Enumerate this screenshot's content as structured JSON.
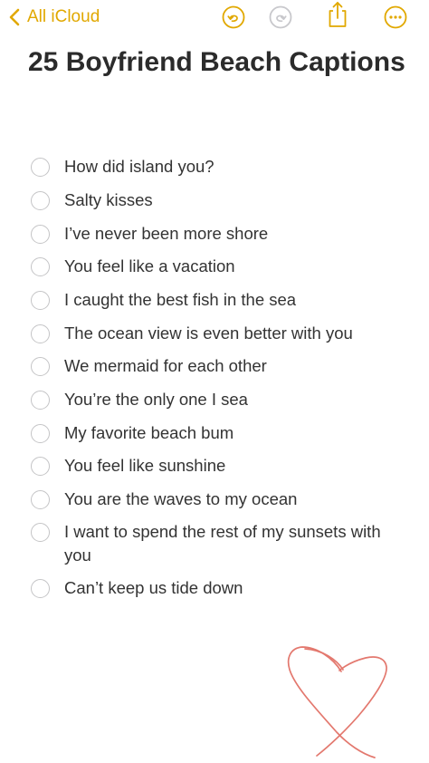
{
  "toolbar": {
    "back_label": "All iCloud",
    "icons": [
      "undo-icon",
      "redo-icon",
      "share-icon",
      "more-icon"
    ],
    "accent_color": "#e1a800",
    "disabled_color": "#c8c8cc"
  },
  "note": {
    "title": "25 Boyfriend Beach Captions",
    "checklist": [
      {
        "text": "How did island you?",
        "checked": false
      },
      {
        "text": "Salty kisses",
        "checked": false
      },
      {
        "text": "I’ve never been more shore",
        "checked": false
      },
      {
        "text": "You feel like a vacation",
        "checked": false
      },
      {
        "text": "I caught the best fish in the sea",
        "checked": false
      },
      {
        "text": "The ocean view is even better with you",
        "checked": false
      },
      {
        "text": "We mermaid for each other",
        "checked": false
      },
      {
        "text": "You’re the only one I sea",
        "checked": false
      },
      {
        "text": "My favorite beach bum",
        "checked": false
      },
      {
        "text": "You feel like sunshine",
        "checked": false
      },
      {
        "text": "You are the waves to my ocean",
        "checked": false
      },
      {
        "text": "I want to spend the rest of my sunsets with you",
        "checked": false
      },
      {
        "text": "Can’t keep us tide down",
        "checked": false
      }
    ],
    "drawing": {
      "icon": "heart-doodle",
      "color": "#e06a5f"
    }
  }
}
